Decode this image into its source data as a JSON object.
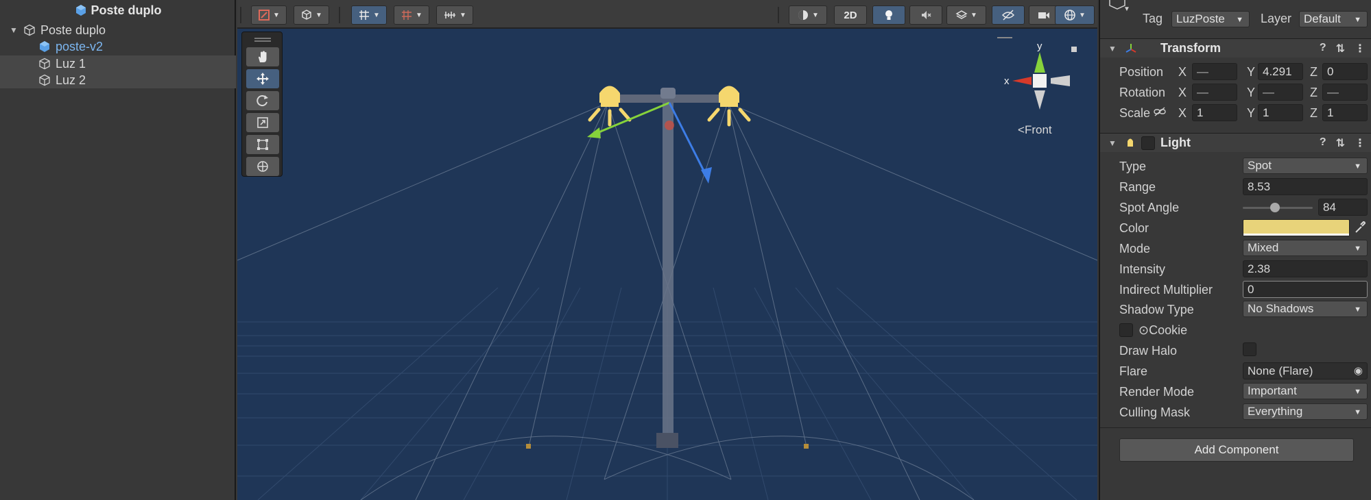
{
  "hierarchy": {
    "scene_title": "Poste duplo",
    "items": [
      {
        "label": "Poste duplo",
        "expanded": true
      },
      {
        "label": "poste-v2",
        "color": "#7cb6f0"
      },
      {
        "label": "Luz 1",
        "selected": true
      },
      {
        "label": "Luz 2",
        "selected": true
      }
    ]
  },
  "scene_toolbar": {
    "toggle_2d": "2D",
    "buttons": [
      "gizmo-tools",
      "render-mode",
      "grid-snapping",
      "increment-snap",
      "ruler",
      "draw-mode",
      "2d-toggle",
      "lighting-toggle",
      "audio-toggle",
      "effects-toggle",
      "visibility-toggle",
      "camera-settings",
      "gizmos"
    ]
  },
  "tool_palette": [
    "hand-tool",
    "move-tool",
    "rotate-tool",
    "scale-tool",
    "rect-tool",
    "transform-tool"
  ],
  "scene_gizmo": {
    "axis_y": "y",
    "axis_x": "x",
    "view_label": "Front"
  },
  "inspector": {
    "tag_label": "Tag",
    "tag_value": "LuzPoste",
    "layer_label": "Layer",
    "layer_value": "Default",
    "transform": {
      "title": "Transform",
      "position_label": "Position",
      "rotation_label": "Rotation",
      "scale_label": "Scale",
      "axis_x": "X",
      "axis_y": "Y",
      "axis_z": "Z",
      "position": {
        "x": "—",
        "y": "4.291",
        "z": "0"
      },
      "rotation": {
        "x": "—",
        "y": "—",
        "z": "—"
      },
      "scale": {
        "x": "1",
        "y": "1",
        "z": "1"
      }
    },
    "light": {
      "title": "Light",
      "type_label": "Type",
      "type_value": "Spot",
      "range_label": "Range",
      "range_value": "8.53",
      "spot_angle_label": "Spot Angle",
      "spot_angle_value": "84",
      "color_label": "Color",
      "color_value": "#e8d37a",
      "mode_label": "Mode",
      "mode_value": "Mixed",
      "intensity_label": "Intensity",
      "intensity_value": "2.38",
      "indirect_label": "Indirect Multiplier",
      "indirect_value": "0",
      "shadow_label": "Shadow Type",
      "shadow_value": "No Shadows",
      "cookie_label": "Cookie",
      "halo_label": "Draw Halo",
      "flare_label": "Flare",
      "flare_value": "None (Flare)",
      "render_mode_label": "Render Mode",
      "render_mode_value": "Important",
      "culling_label": "Culling Mask",
      "culling_value": "Everything"
    },
    "add_component": "Add Component"
  },
  "colors": {
    "scene_bg": "#1f3657",
    "accent_blue": "#46607f",
    "light_yellow": "#f5d76e"
  }
}
